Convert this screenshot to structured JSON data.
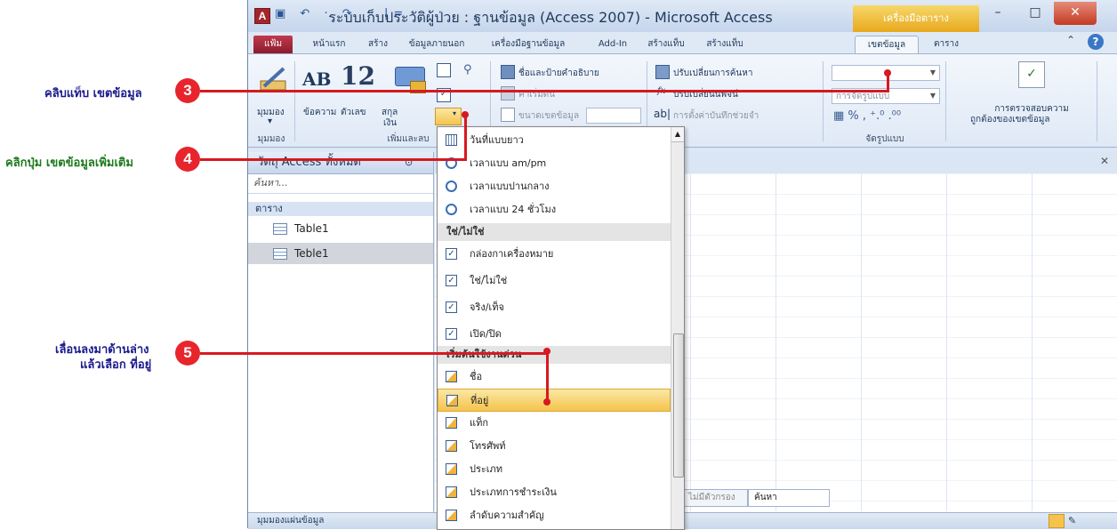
{
  "window": {
    "title": "ระบบเก็บประวัติผู้ป่วย : ฐานข้อมูล (Access 2007) - Microsoft Access",
    "context_tab_title": "เครื่องมือตาราง",
    "app_icon": "A",
    "qat": "▣ ↶ · ↷ · |=",
    "min": "–",
    "max": "□",
    "close": "✕"
  },
  "ribbon_tabs": [
    "แฟ้ม",
    "หน้าแรก",
    "สร้าง",
    "ข้อมูลภายนอก",
    "เครื่องมือฐานข้อมูล",
    "Add-In",
    "สร้างแท็บ",
    "สร้างแท็บ",
    "เขตข้อมูล",
    "ตาราง"
  ],
  "ribbon": {
    "views_label": "มุมมอง",
    "views_group": "มุมมอง",
    "text_label": "ข้อความ",
    "number_label": "ตัวเลข",
    "currency_label_1": "สกุล",
    "currency_label_2": "เงิน",
    "add_delete_group": "เพิ่มและลบ",
    "ab": "AB",
    "twelve": "12",
    "name_caption": "ชื่อและป้ายคำอธิบาย",
    "default_value": "ค่าเริ่มต้น",
    "field_size": "ขนาดเขตข้อมูล",
    "modify_lookups": "ปรับเปลี่ยนการค้นหา",
    "modify_expression": "ปรับเปลี่ยนนิพจน์",
    "memo_settings": "การตั้งค่าบันทึกช่วยจำ",
    "format_label": "การจัดรูปแบบ",
    "format_group": "จัดรูปแบบ",
    "validation_1": "การตรวจสอบความ",
    "validation_2": "ถูกต้องของเขตข้อมูล",
    "fx": "fx",
    "ab_icon": "ab|"
  },
  "nav_pane": {
    "header": "วัตถุ Access ทั้งหมด",
    "search_placeholder": "ค้นหา...",
    "group": "ตาราง",
    "items": [
      "Table1",
      "Teble1"
    ]
  },
  "dropdown": {
    "items": [
      {
        "label": "วันที่แบบยาว",
        "icon": "calendar-icon"
      },
      {
        "label": "เวลาแบบ am/pm",
        "icon": "clock-icon"
      },
      {
        "label": "เวลาแบบปานกลาง",
        "icon": "clock-icon"
      },
      {
        "label": "เวลาแบบ 24 ชั่วโมง",
        "icon": "clock-icon"
      }
    ],
    "header_yesno": "ใช่/ไม่ใช่",
    "yesno_items": [
      "กล่องกาเครื่องหมาย",
      "ใช่/ไม่ใช่",
      "จริง/เท็จ",
      "เปิด/ปิด"
    ],
    "header_quick": "เริ่มต้นใช้งานด่วน",
    "quick_items": [
      "ชื่อ",
      "ที่อยู่",
      "แท็ก",
      "โทรศัพท์",
      "ประเภท",
      "ประเภทการชำระเงิน",
      "ลำดับความสำคัญ"
    ],
    "highlighted": "ที่อยู่"
  },
  "status": {
    "view_label": "มุมมองแผ่นข้อมูล",
    "no_filter": "ไม่มีตัวกรอง",
    "search": "ค้นหา"
  },
  "callouts": [
    {
      "number": "3",
      "text": "คลิบแท็บ เขตข้อมูล"
    },
    {
      "number": "4",
      "text": "คลิกปุ่ม เขตข้อมูลเพิ่มเติม"
    },
    {
      "number": "5",
      "line1": "เลื่อนลงมาด้านล่าง",
      "line2": "แล้วเลือก ที่อยู่"
    }
  ],
  "colors": {
    "callout_red": "#d71920",
    "highlight": "#f5c34d",
    "ribbon_bg": "#dfe9f6"
  }
}
